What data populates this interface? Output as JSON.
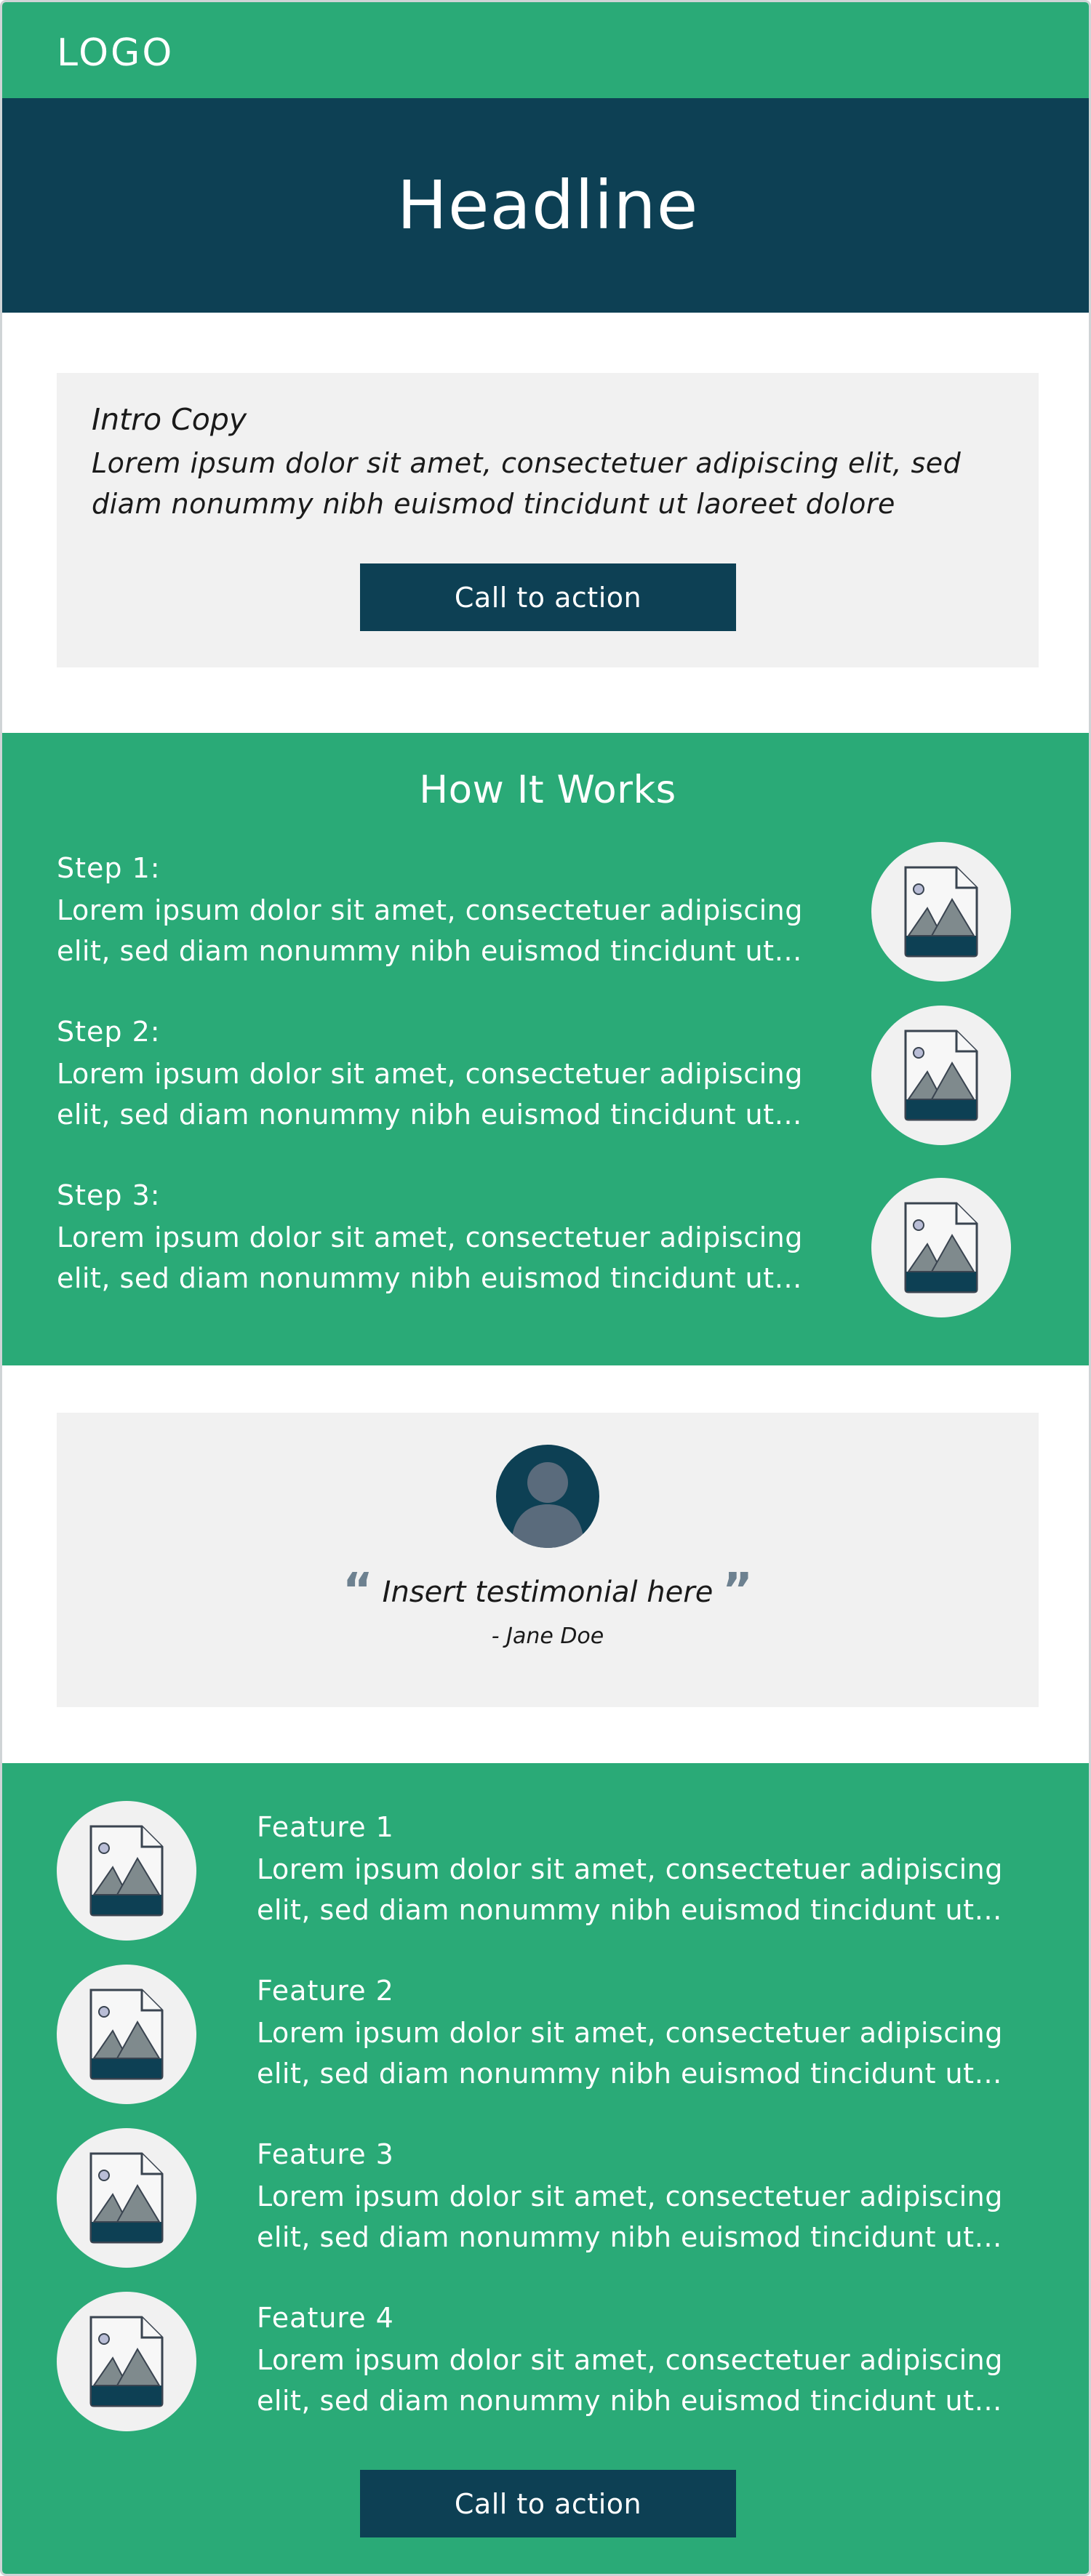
{
  "header": {
    "logo": "LOGO"
  },
  "hero": {
    "headline": "Headline"
  },
  "intro": {
    "label": "Intro Copy",
    "body": "Lorem ipsum dolor sit amet, consectetuer adipiscing elit, sed diam nonummy nibh euismod tincidunt ut laoreet dolore",
    "cta_label": "Call to action"
  },
  "how_it_works": {
    "title": "How It Works",
    "steps": [
      {
        "label": "Step 1:",
        "line1": "Lorem ipsum dolor sit amet, consectetuer adipiscing",
        "line2": "elit, sed diam nonummy nibh euismod tincidunt ut…",
        "icon": "image-placeholder-icon"
      },
      {
        "label": "Step 2:",
        "line1": "Lorem ipsum dolor sit amet, consectetuer adipiscing",
        "line2": "elit, sed diam nonummy nibh euismod tincidunt ut…",
        "icon": "image-placeholder-icon"
      },
      {
        "label": "Step 3:",
        "line1": "Lorem ipsum dolor sit amet, consectetuer adipiscing",
        "line2": "elit, sed diam nonummy nibh euismod tincidunt ut…",
        "icon": "image-placeholder-icon"
      }
    ]
  },
  "testimonial": {
    "open_quote": "“",
    "quote": "Insert testimonial here",
    "close_quote": "”",
    "author": "- Jane Doe",
    "avatar_icon": "avatar-icon"
  },
  "features": {
    "items": [
      {
        "label": "Feature 1",
        "line1": "Lorem ipsum dolor sit amet, consectetuer adipiscing",
        "line2": "elit, sed diam nonummy nibh euismod tincidunt ut…",
        "icon": "image-placeholder-icon"
      },
      {
        "label": "Feature 2",
        "line1": "Lorem ipsum dolor sit amet, consectetuer adipiscing",
        "line2": "elit, sed diam nonummy nibh euismod tincidunt ut…",
        "icon": "image-placeholder-icon"
      },
      {
        "label": "Feature 3",
        "line1": "Lorem ipsum dolor sit amet, consectetuer adipiscing",
        "line2": "elit, sed diam nonummy nibh euismod tincidunt ut…",
        "icon": "image-placeholder-icon"
      },
      {
        "label": "Feature 4",
        "line1": "Lorem ipsum dolor sit amet, consectetuer adipiscing",
        "line2": "elit, sed diam nonummy nibh euismod tincidunt ut…",
        "icon": "image-placeholder-icon"
      }
    ],
    "cta_label": "Call to action"
  },
  "colors": {
    "brand_green": "#2aaa77",
    "brand_navy": "#0d4054",
    "panel_gray": "#f1f1f1"
  }
}
